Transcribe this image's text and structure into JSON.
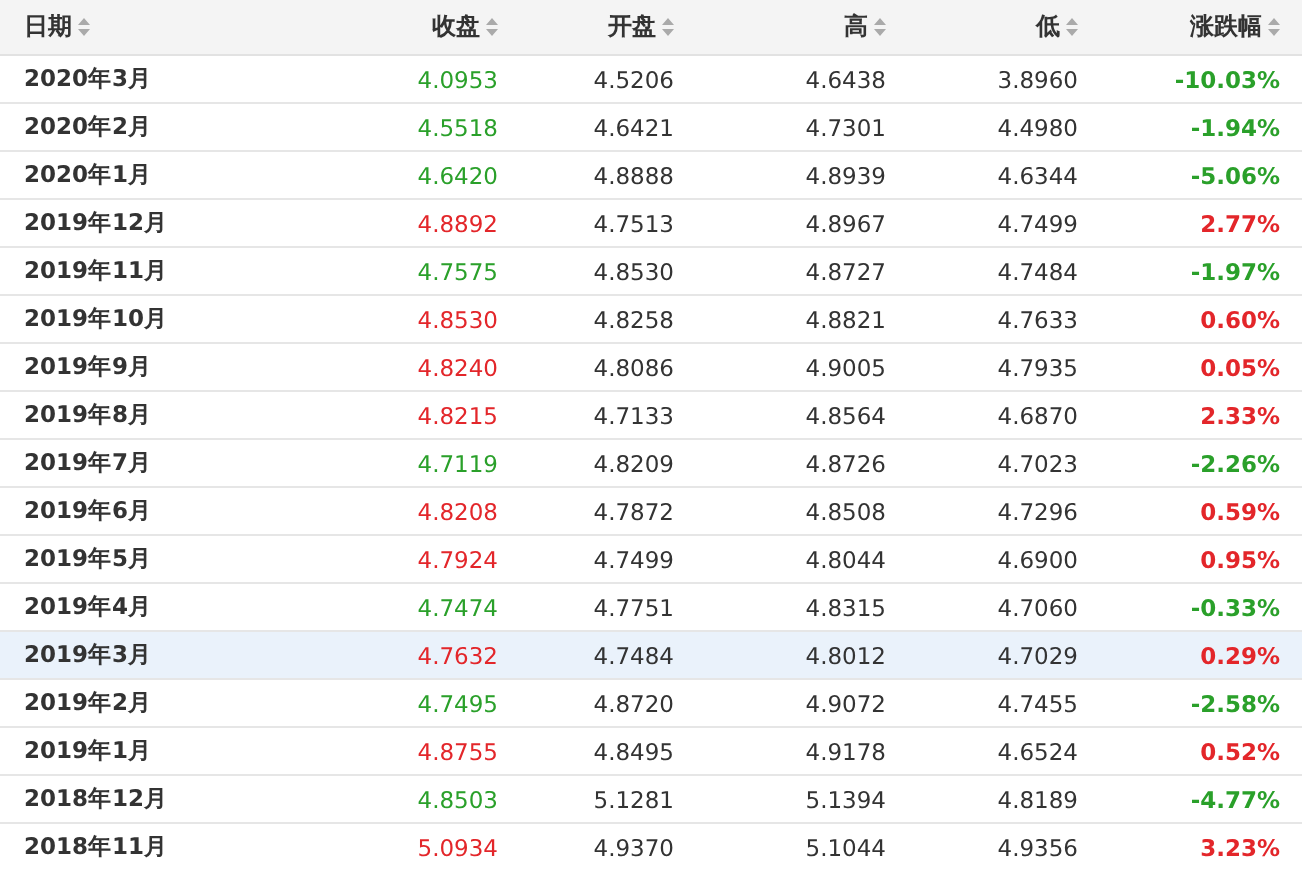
{
  "table": {
    "columns": [
      {
        "label": "日期"
      },
      {
        "label": "收盘"
      },
      {
        "label": "开盘"
      },
      {
        "label": "高"
      },
      {
        "label": "低"
      },
      {
        "label": "涨跌幅"
      }
    ],
    "rows": [
      {
        "date": "2020年3月",
        "close": "4.0953",
        "open": "4.5206",
        "high": "4.6438",
        "low": "3.8960",
        "change": "-10.03%",
        "color": "#2aa02a",
        "selected": false
      },
      {
        "date": "2020年2月",
        "close": "4.5518",
        "open": "4.6421",
        "high": "4.7301",
        "low": "4.4980",
        "change": "-1.94%",
        "color": "#2aa02a",
        "selected": false
      },
      {
        "date": "2020年1月",
        "close": "4.6420",
        "open": "4.8888",
        "high": "4.8939",
        "low": "4.6344",
        "change": "-5.06%",
        "color": "#2aa02a",
        "selected": false
      },
      {
        "date": "2019年12月",
        "close": "4.8892",
        "open": "4.7513",
        "high": "4.8967",
        "low": "4.7499",
        "change": "2.77%",
        "color": "#e3262a",
        "selected": false
      },
      {
        "date": "2019年11月",
        "close": "4.7575",
        "open": "4.8530",
        "high": "4.8727",
        "low": "4.7484",
        "change": "-1.97%",
        "color": "#2aa02a",
        "selected": false
      },
      {
        "date": "2019年10月",
        "close": "4.8530",
        "open": "4.8258",
        "high": "4.8821",
        "low": "4.7633",
        "change": "0.60%",
        "color": "#e3262a",
        "selected": false
      },
      {
        "date": "2019年9月",
        "close": "4.8240",
        "open": "4.8086",
        "high": "4.9005",
        "low": "4.7935",
        "change": "0.05%",
        "color": "#e3262a",
        "selected": false
      },
      {
        "date": "2019年8月",
        "close": "4.8215",
        "open": "4.7133",
        "high": "4.8564",
        "low": "4.6870",
        "change": "2.33%",
        "color": "#e3262a",
        "selected": false
      },
      {
        "date": "2019年7月",
        "close": "4.7119",
        "open": "4.8209",
        "high": "4.8726",
        "low": "4.7023",
        "change": "-2.26%",
        "color": "#2aa02a",
        "selected": false
      },
      {
        "date": "2019年6月",
        "close": "4.8208",
        "open": "4.7872",
        "high": "4.8508",
        "low": "4.7296",
        "change": "0.59%",
        "color": "#e3262a",
        "selected": false
      },
      {
        "date": "2019年5月",
        "close": "4.7924",
        "open": "4.7499",
        "high": "4.8044",
        "low": "4.6900",
        "change": "0.95%",
        "color": "#e3262a",
        "selected": false
      },
      {
        "date": "2019年4月",
        "close": "4.7474",
        "open": "4.7751",
        "high": "4.8315",
        "low": "4.7060",
        "change": "-0.33%",
        "color": "#2aa02a",
        "selected": false
      },
      {
        "date": "2019年3月",
        "close": "4.7632",
        "open": "4.7484",
        "high": "4.8012",
        "low": "4.7029",
        "change": "0.29%",
        "color": "#e3262a",
        "selected": true
      },
      {
        "date": "2019年2月",
        "close": "4.7495",
        "open": "4.8720",
        "high": "4.9072",
        "low": "4.7455",
        "change": "-2.58%",
        "color": "#2aa02a",
        "selected": false
      },
      {
        "date": "2019年1月",
        "close": "4.8755",
        "open": "4.8495",
        "high": "4.9178",
        "low": "4.6524",
        "change": "0.52%",
        "color": "#e3262a",
        "selected": false
      },
      {
        "date": "2018年12月",
        "close": "4.8503",
        "open": "5.1281",
        "high": "5.1394",
        "low": "4.8189",
        "change": "-4.77%",
        "color": "#2aa02a",
        "selected": false
      },
      {
        "date": "2018年11月",
        "close": "5.0934",
        "open": "4.9370",
        "high": "5.1044",
        "low": "4.9356",
        "change": "3.23%",
        "color": "#e3262a",
        "selected": false
      }
    ]
  }
}
